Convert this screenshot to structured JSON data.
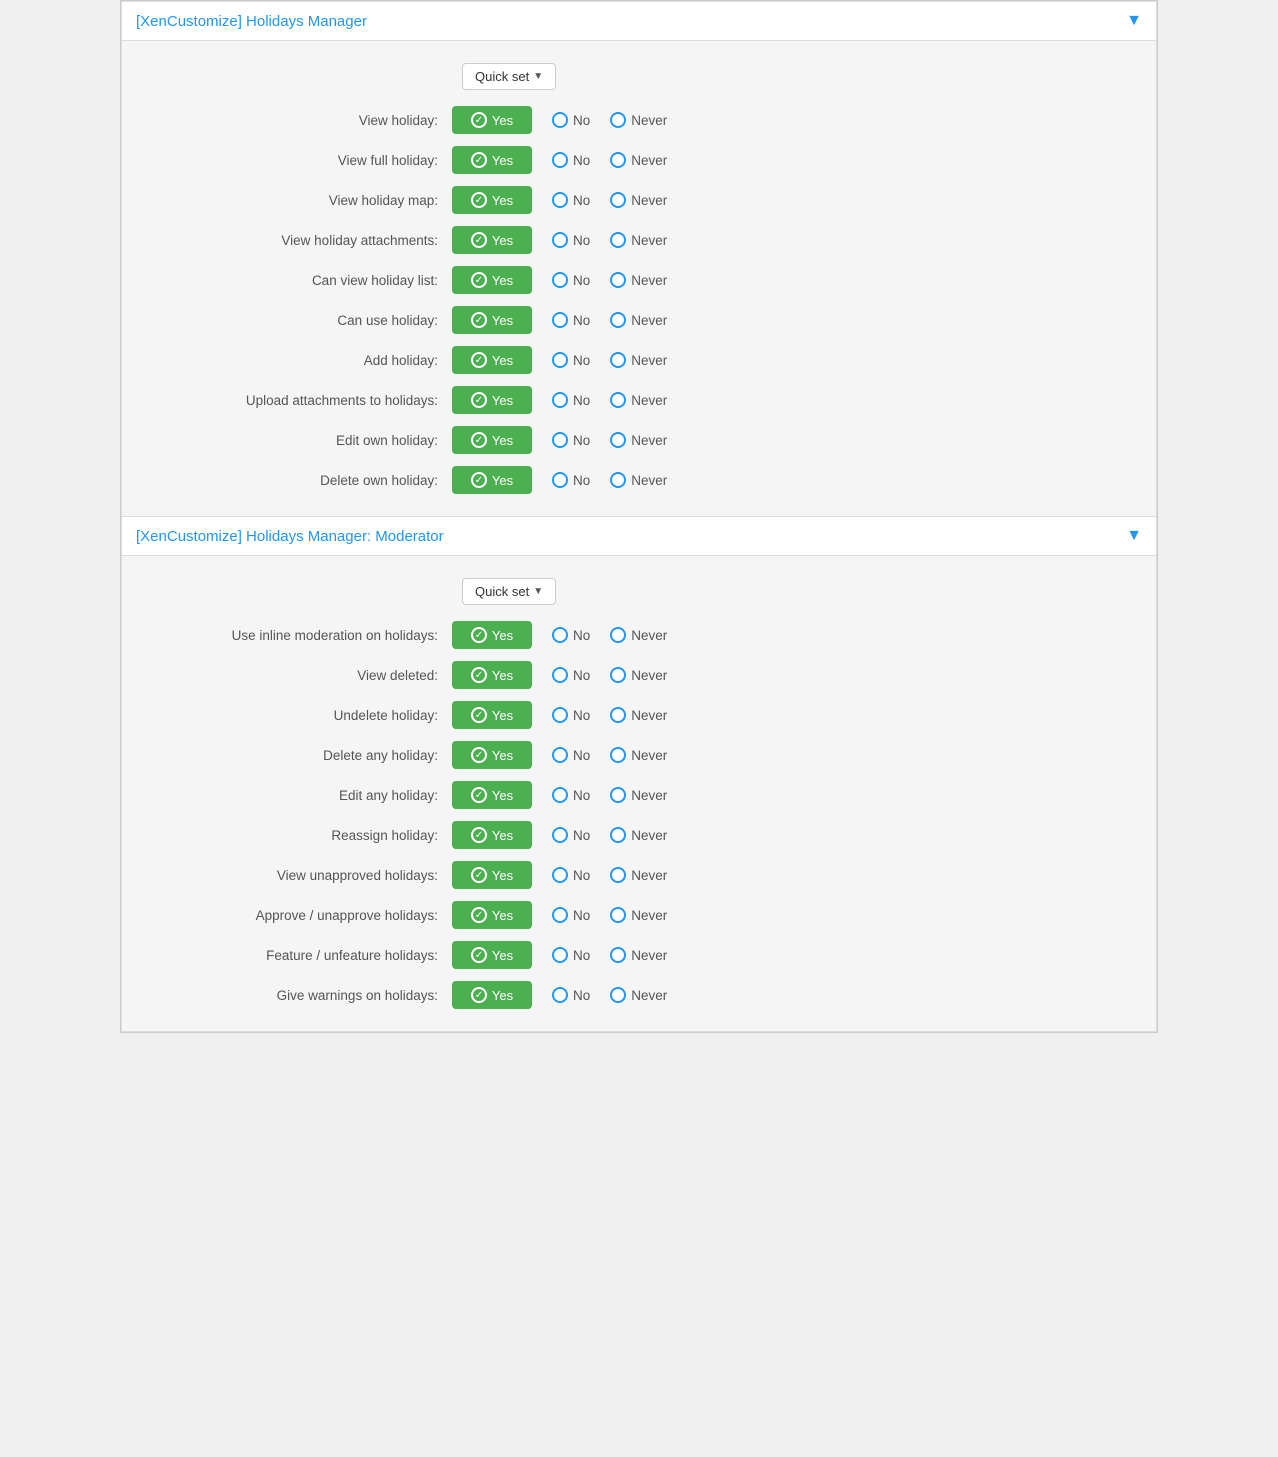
{
  "sections": [
    {
      "id": "section-1",
      "title": "[XenCustomize] Holidays Manager",
      "toggle": "▼",
      "quick_set_label": "Quick set",
      "permissions": [
        {
          "label": "View holiday:",
          "yes": "Yes",
          "no": "No",
          "never": "Never"
        },
        {
          "label": "View full holiday:",
          "yes": "Yes",
          "no": "No",
          "never": "Never"
        },
        {
          "label": "View holiday map:",
          "yes": "Yes",
          "no": "No",
          "never": "Never"
        },
        {
          "label": "View holiday attachments:",
          "yes": "Yes",
          "no": "No",
          "never": "Never"
        },
        {
          "label": "Can view holiday list:",
          "yes": "Yes",
          "no": "No",
          "never": "Never"
        },
        {
          "label": "Can use holiday:",
          "yes": "Yes",
          "no": "No",
          "never": "Never"
        },
        {
          "label": "Add holiday:",
          "yes": "Yes",
          "no": "No",
          "never": "Never"
        },
        {
          "label": "Upload attachments to holidays:",
          "yes": "Yes",
          "no": "No",
          "never": "Never"
        },
        {
          "label": "Edit own holiday:",
          "yes": "Yes",
          "no": "No",
          "never": "Never"
        },
        {
          "label": "Delete own holiday:",
          "yes": "Yes",
          "no": "No",
          "never": "Never"
        }
      ]
    },
    {
      "id": "section-2",
      "title": "[XenCustomize] Holidays Manager: Moderator",
      "toggle": "▼",
      "quick_set_label": "Quick set",
      "permissions": [
        {
          "label": "Use inline moderation on holidays:",
          "yes": "Yes",
          "no": "No",
          "never": "Never"
        },
        {
          "label": "View deleted:",
          "yes": "Yes",
          "no": "No",
          "never": "Never"
        },
        {
          "label": "Undelete holiday:",
          "yes": "Yes",
          "no": "No",
          "never": "Never"
        },
        {
          "label": "Delete any holiday:",
          "yes": "Yes",
          "no": "No",
          "never": "Never"
        },
        {
          "label": "Edit any holiday:",
          "yes": "Yes",
          "no": "No",
          "never": "Never"
        },
        {
          "label": "Reassign holiday:",
          "yes": "Yes",
          "no": "No",
          "never": "Never"
        },
        {
          "label": "View unapproved holidays:",
          "yes": "Yes",
          "no": "No",
          "never": "Never"
        },
        {
          "label": "Approve / unapprove holidays:",
          "yes": "Yes",
          "no": "No",
          "never": "Never"
        },
        {
          "label": "Feature / unfeature holidays:",
          "yes": "Yes",
          "no": "No",
          "never": "Never"
        },
        {
          "label": "Give warnings on holidays:",
          "yes": "Yes",
          "no": "No",
          "never": "Never"
        }
      ]
    }
  ]
}
